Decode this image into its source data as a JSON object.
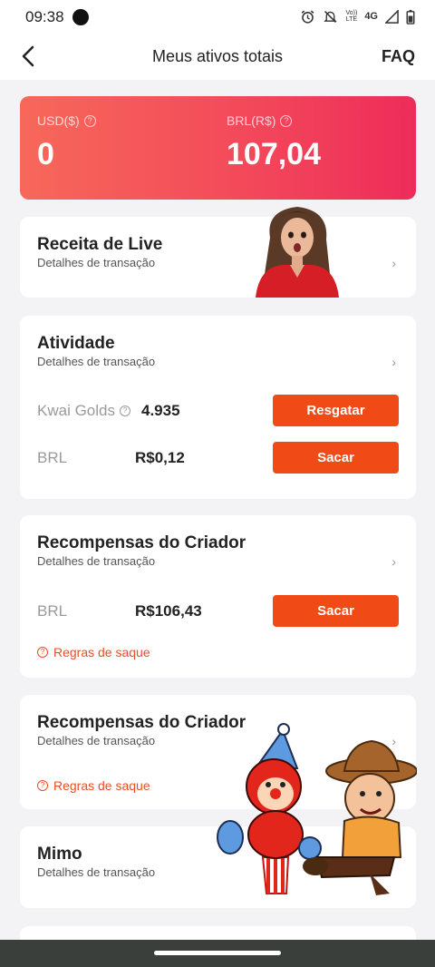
{
  "status_bar": {
    "time": "09:38",
    "net_top": "Vo))",
    "net_bottom": "LTE",
    "network": "4G"
  },
  "header": {
    "title": "Meus ativos totais",
    "faq": "FAQ"
  },
  "balance": {
    "usd_label": "USD($)",
    "usd_value": "0",
    "brl_label": "BRL(R$)",
    "brl_value": "107,04",
    "gradient_start": "#f7685a",
    "gradient_end": "#ee2c5a"
  },
  "cards": {
    "live": {
      "title": "Receita de Live",
      "subtitle": "Detalhes de transação"
    },
    "activity": {
      "title": "Atividade",
      "subtitle": "Detalhes de transação",
      "golds_label": "Kwai Golds",
      "golds_value": "4.935",
      "golds_button": "Resgatar",
      "brl_label": "BRL",
      "brl_value": "R$0,12",
      "brl_button": "Sacar"
    },
    "creator1": {
      "title": "Recompensas do Criador",
      "subtitle": "Detalhes de transação",
      "brl_label": "BRL",
      "brl_value": "R$106,43",
      "button": "Sacar",
      "rules": "Regras de saque"
    },
    "creator2": {
      "title": "Recompensas do Criador",
      "subtitle": "Detalhes de transação",
      "rules": "Regras de saque"
    },
    "mimo": {
      "title": "Mimo",
      "subtitle": "Detalhes de transação"
    }
  },
  "icons": {
    "back": "back-arrow-icon",
    "help": "question-circle-icon",
    "chevron": "chevron-right-icon"
  },
  "colors": {
    "accent": "#f04a16",
    "link": "#ef4b24"
  }
}
